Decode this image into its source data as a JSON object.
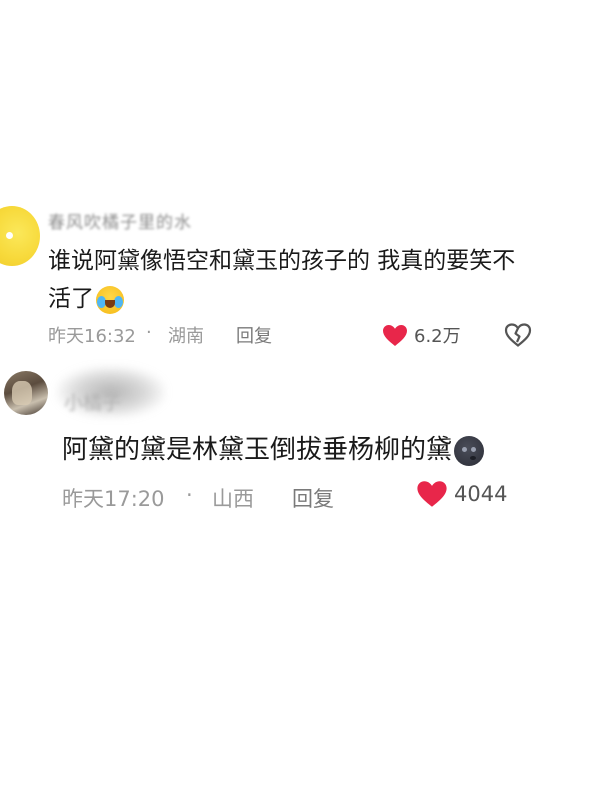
{
  "comments": [
    {
      "username": "春风吹橘子里的水",
      "text": "谁说阿黛像悟空和黛玉的孩子的 我真的要笑不活了",
      "emoji": "loudly-crying-face",
      "time": "昨天16:32",
      "separator": "·",
      "location": "湖南",
      "reply_label": "回复",
      "like_count": "6.2万"
    },
    {
      "username": "小橘子",
      "text": "阿黛的黛是林黛玉倒拔垂杨柳的黛",
      "emoji": "new-moon-face",
      "time": "昨天17:20",
      "separator": "·",
      "location": "山西",
      "reply_label": "回复",
      "like_count": "4044"
    }
  ],
  "colors": {
    "like_heart": "#e8264a",
    "meta_text": "#9a9a9a",
    "body_text": "#1a1a1a"
  },
  "icons": {
    "like": "heart-icon",
    "dislike": "broken-heart-icon"
  }
}
